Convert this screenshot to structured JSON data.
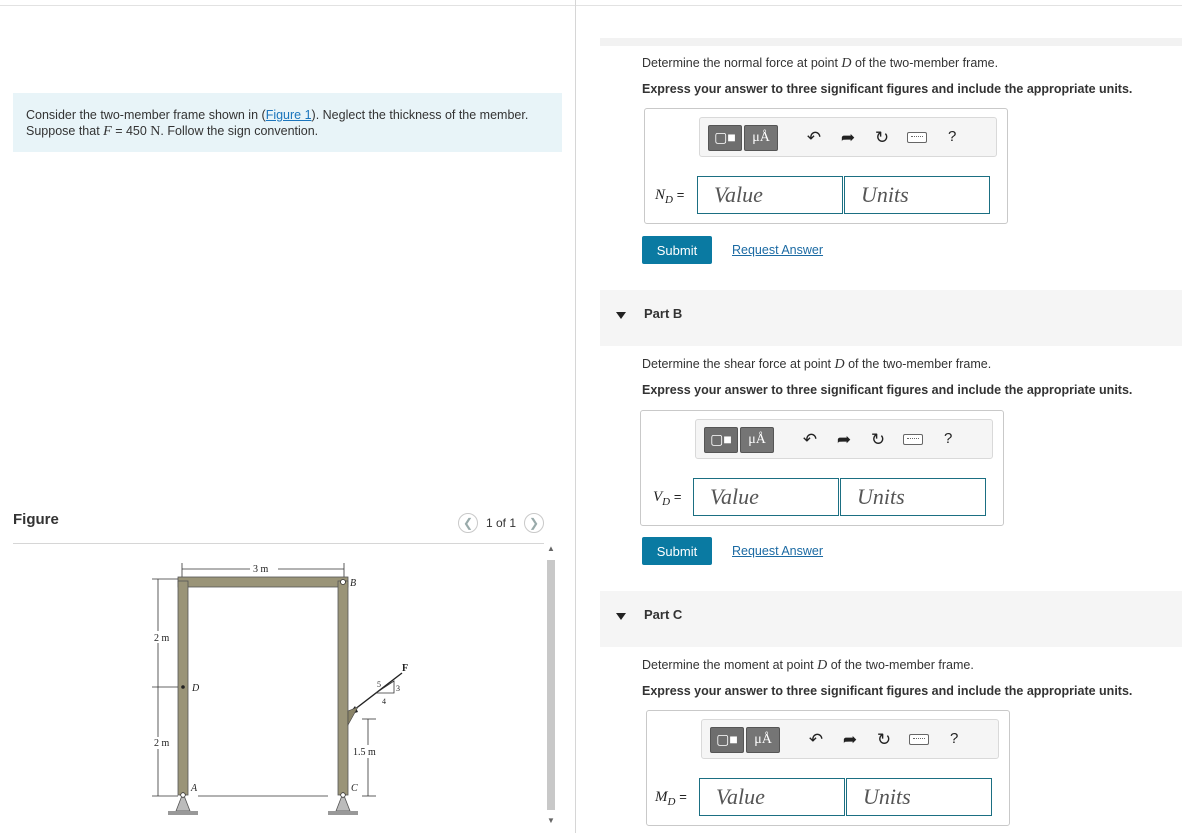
{
  "problem": {
    "text1": "Consider the two-member frame shown in (",
    "figure_link": "Figure 1",
    "text2": "). Neglect the thickness of the member.",
    "text3": "Suppose that ",
    "F_var": "F",
    "text4": " = 450 ",
    "unit": "N",
    "text5": ". Follow the sign convention."
  },
  "figure": {
    "label": "Figure",
    "pager": "1 of 1",
    "dim_width": "3 m",
    "dim_h1": "2 m",
    "dim_h2": "2 m",
    "dim_c": "1.5 m",
    "pt_B": "B",
    "pt_D": "D",
    "pt_A": "A",
    "pt_C": "C",
    "pt_F": "F",
    "tri_5": "5",
    "tri_3": "3",
    "tri_4": "4"
  },
  "partA": {
    "prompt_pre": "Determine the normal force at point ",
    "prompt_pt": "D",
    "prompt_post": " of the two-member frame.",
    "express": "Express your answer to three significant figures and include the appropriate units.",
    "var_label": "N",
    "var_sub": "D",
    "eq": "=",
    "value_placeholder": "Value",
    "units_placeholder": "Units",
    "submit": "Submit",
    "request": "Request Answer"
  },
  "partB": {
    "header": "Part B",
    "prompt_pre": "Determine the shear force at point ",
    "prompt_pt": "D",
    "prompt_post": " of the two-member frame.",
    "express": "Express your answer to three significant figures and include the appropriate units.",
    "var_label": "V",
    "var_sub": "D",
    "eq": "=",
    "value_placeholder": "Value",
    "units_placeholder": "Units",
    "submit": "Submit",
    "request": "Request Answer"
  },
  "partC": {
    "header": "Part C",
    "prompt_pre": "Determine the moment at point ",
    "prompt_pt": "D",
    "prompt_post": " of the two-member frame.",
    "express": "Express your answer to three significant figures and include the appropriate units.",
    "var_label": "M",
    "var_sub": "D",
    "eq": "=",
    "value_placeholder": "Value",
    "units_placeholder": "Units"
  },
  "toolbar": {
    "units_btn": "μÅ",
    "help": "?"
  }
}
